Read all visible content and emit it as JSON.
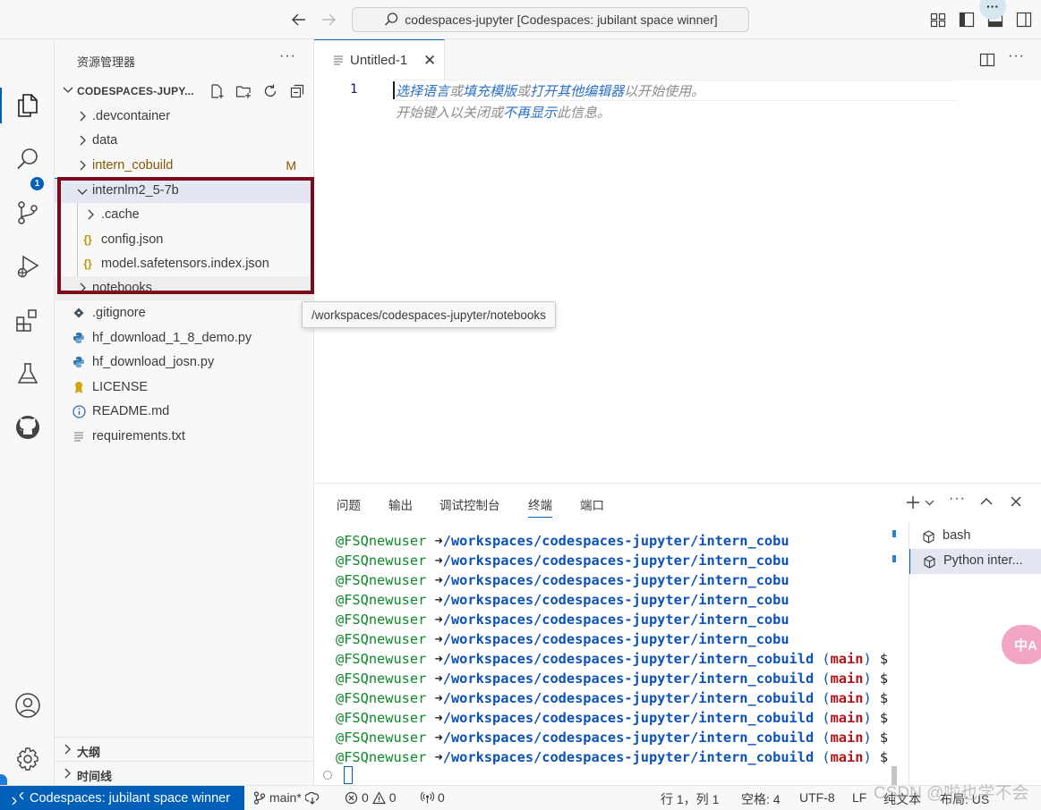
{
  "title_bar": {
    "command_center": "codespaces-jupyter [Codespaces: jubilant space winner]",
    "more": "···"
  },
  "activity_bar": {
    "scm_badge": "1"
  },
  "sidebar": {
    "title": "资源管理器",
    "folder_name": "CODESPACES-JUPY...",
    "items": [
      {
        "label": ".devcontainer",
        "type": "folder"
      },
      {
        "label": "data",
        "type": "folder"
      },
      {
        "label": "intern_cobuild",
        "type": "folder",
        "git_status": "M"
      },
      {
        "label": "internlm2_5-7b",
        "type": "folder-open"
      },
      {
        "label": ".cache",
        "type": "folder"
      },
      {
        "label": "config.json",
        "type": "json"
      },
      {
        "label": "model.safetensors.index.json",
        "type": "json"
      },
      {
        "label": "notebooks",
        "type": "folder"
      },
      {
        "label": ".gitignore",
        "type": "git"
      },
      {
        "label": "hf_download_1_8_demo.py",
        "type": "python"
      },
      {
        "label": "hf_download_josn.py",
        "type": "python"
      },
      {
        "label": "LICENSE",
        "type": "license"
      },
      {
        "label": "README.md",
        "type": "info"
      },
      {
        "label": "requirements.txt",
        "type": "text"
      }
    ],
    "outline_label": "大纲",
    "timeline_label": "时间线"
  },
  "tooltip": "/workspaces/codespaces-jupyter/notebooks",
  "editor": {
    "tab_label": "Untitled-1",
    "line_number": "1",
    "hint_line1": {
      "p1": "选择语言",
      "p2": "或",
      "p3": "填充模版",
      "p4": "或",
      "p5": "打开其他编辑器",
      "p6": "以开始使用。"
    },
    "hint_line2": {
      "p1": "开始键入以关闭或",
      "p2": "不再显示",
      "p3": "此信息。"
    }
  },
  "panel": {
    "tabs": [
      "问题",
      "输出",
      "调试控制台",
      "终端",
      "端口"
    ],
    "active_tab": "终端",
    "terminal_user": "@FSQnewuser",
    "terminal_arrow": "➜",
    "terminal_lines": [
      {
        "path": "/workspaces/codespaces-jupyter/intern_cobu"
      },
      {
        "path": "/workspaces/codespaces-jupyter/intern_cobu"
      },
      {
        "path": "/workspaces/codespaces-jupyter/intern_cobu"
      },
      {
        "path": "/workspaces/codespaces-jupyter/intern_cobu"
      },
      {
        "path": "/workspaces/codespaces-jupyter/intern_cobu"
      },
      {
        "path": "/workspaces/codespaces-jupyter/intern_cobu"
      },
      {
        "path": "/workspaces/codespaces-jupyter/intern_cobuild",
        "branch": "main"
      },
      {
        "path": "/workspaces/codespaces-jupyter/intern_cobuild",
        "branch": "main"
      },
      {
        "path": "/workspaces/codespaces-jupyter/intern_cobuild",
        "branch": "main"
      },
      {
        "path": "/workspaces/codespaces-jupyter/intern_cobuild",
        "branch": "main"
      },
      {
        "path": "/workspaces/codespaces-jupyter/intern_cobuild",
        "branch": "main"
      },
      {
        "path": "/workspaces/codespaces-jupyter/intern_cobuild",
        "branch": "main"
      }
    ],
    "terminals": [
      {
        "label": "bash"
      },
      {
        "label": "Python inter..."
      }
    ]
  },
  "translate_bubble": "中A",
  "status_bar": {
    "remote": "Codespaces: jubilant space winner",
    "branch": "main*",
    "errors": "0",
    "warnings": "0",
    "ports": "0",
    "position": "行 1，列 1",
    "spaces": "空格: 4",
    "encoding": "UTF-8",
    "eol": "LF",
    "language": "纯文本",
    "layout": "布局: US"
  },
  "watermark": "CSDN @啦也学不会",
  "colors": {
    "accent": "#005fb8",
    "highlight_box": "#7b0a1d",
    "git_modified": "#895503",
    "terminal_user": "#0d8a28",
    "terminal_path": "#0c52b8",
    "terminal_branch": "#b3131c"
  }
}
